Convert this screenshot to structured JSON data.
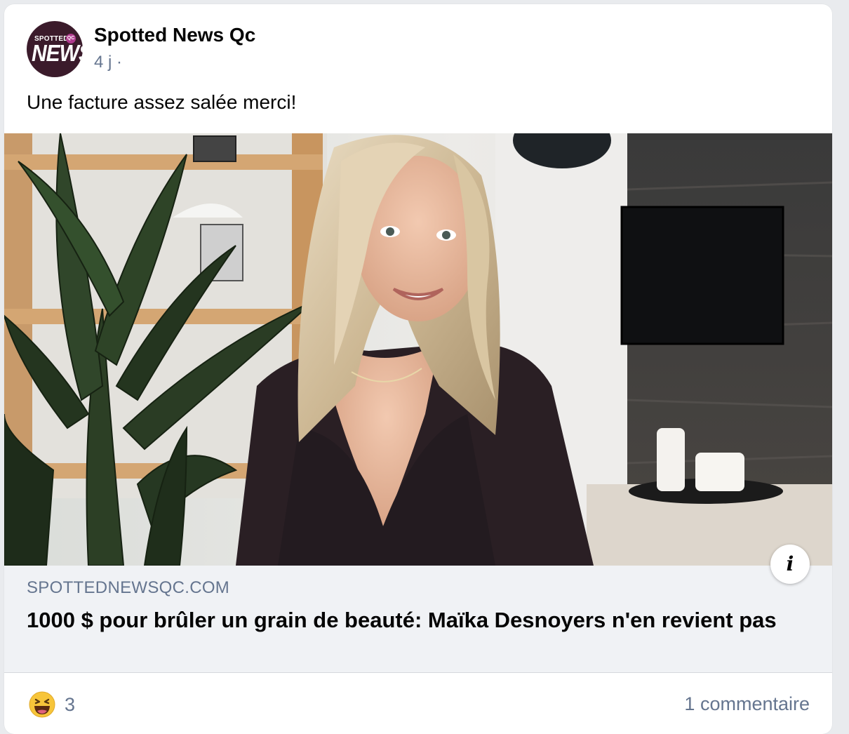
{
  "post": {
    "page_name": "Spotted News Qc",
    "timestamp": "4 j ·",
    "text": "Une facture assez salée merci!",
    "avatar": {
      "line1": "SPOTTED",
      "badge": "QC",
      "line2": "NEWS"
    }
  },
  "link": {
    "domain": "SPOTTEDNEWSQC.COM",
    "title": "1000 $ pour brûler un grain de beauté: Maïka Desnoyers n'en revient pas",
    "info_icon": "i"
  },
  "footer": {
    "reaction_icon": "haha-emoji-icon",
    "reaction_count": "3",
    "comments": "1 commentaire"
  },
  "colors": {
    "secondary_text": "#65758f",
    "card_bg": "#ffffff",
    "link_bg": "#f0f2f5"
  }
}
